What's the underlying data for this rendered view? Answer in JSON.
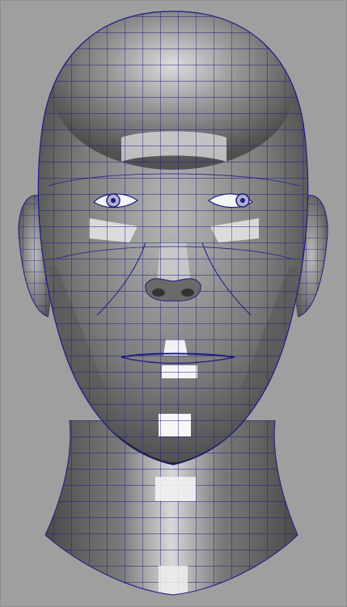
{
  "viewport": {
    "background_color": "#9f9f9f",
    "wire_color": "#1c1c86",
    "shading": "smooth-shaded-with-wireframe"
  },
  "model": {
    "subject": "head-mesh",
    "view": "front"
  }
}
